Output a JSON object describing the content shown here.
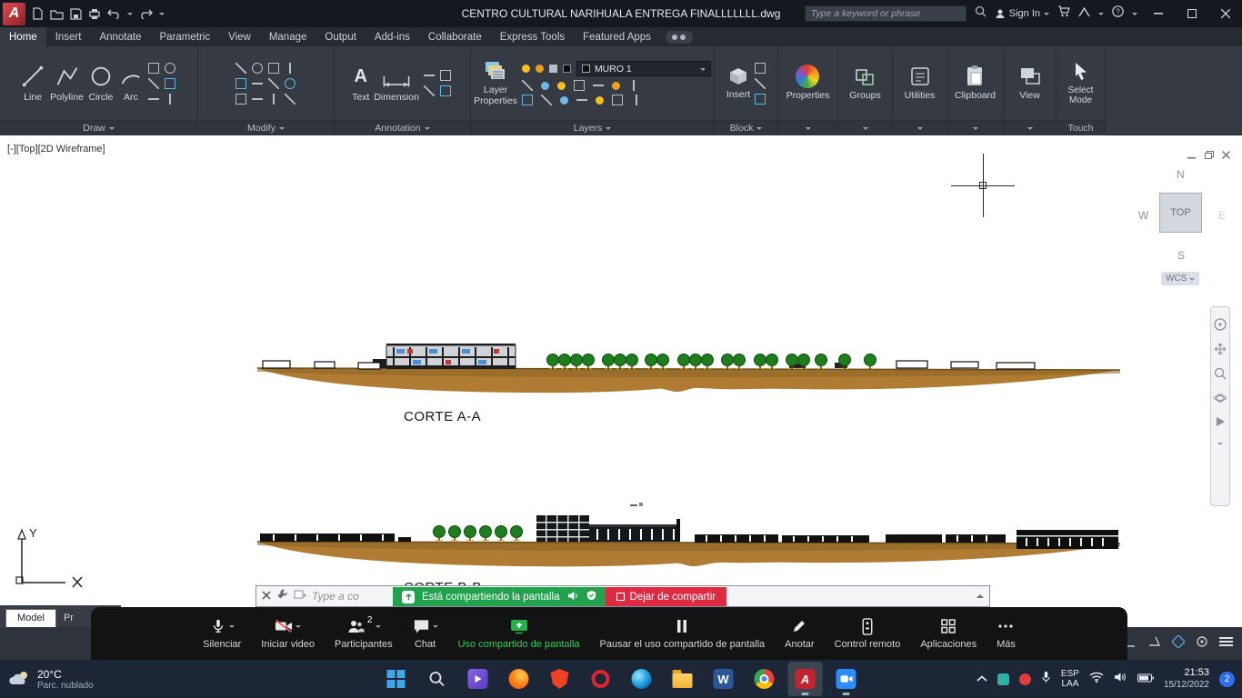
{
  "colors": {
    "terrain": "#b07c33",
    "terrain-stroke": "#6e4f1c",
    "tree": "#1e7e1e",
    "tree-stroke": "#0e4d0e",
    "share-green": "#23a24d",
    "stop-red": "#de2a43",
    "autocad-red": "#c2242f"
  },
  "logos": {
    "autocad_letter": "A",
    "word_letter": "W"
  },
  "titlebar": {
    "title": "CENTRO CULTURAL NARIHUALA ENTREGA FINALLLLLLL.dwg",
    "search_placeholder": "Type a keyword or phrase",
    "signin_label": "Sign In"
  },
  "ribbon": {
    "tabs": [
      "Home",
      "Insert",
      "Annotate",
      "Parametric",
      "View",
      "Manage",
      "Output",
      "Add-ins",
      "Collaborate",
      "Express Tools",
      "Featured Apps"
    ],
    "panels": {
      "draw": {
        "label": "Draw",
        "tools": [
          "Line",
          "Polyline",
          "Circle",
          "Arc"
        ]
      },
      "modify": {
        "label": "Modify"
      },
      "annotation": {
        "label": "Annotation",
        "tools": [
          "Text",
          "Dimension"
        ],
        "text_icon_letter": "A"
      },
      "layers": {
        "label": "Layers",
        "layer_properties": "Layer Properties",
        "current_layer": "MURO 1"
      },
      "block": {
        "label": "Block",
        "insert": "Insert"
      },
      "properties": {
        "label": "Properties"
      },
      "groups": {
        "label": "Groups"
      },
      "utilities": {
        "label": "Utilities"
      },
      "clipboard": {
        "label": "Clipboard"
      },
      "view": {
        "label": "View"
      },
      "select_mode": {
        "label": "Select Mode",
        "footer": "Touch"
      }
    }
  },
  "canvas": {
    "viewport_label": "[-][Top][2D Wireframe]",
    "viewcube": {
      "n": "N",
      "w": "W",
      "e": "E",
      "s": "S",
      "top": "TOP",
      "wcs": "WCS"
    },
    "sections": [
      {
        "label": "CORTE A-A"
      },
      {
        "label": "CORTE B-B"
      }
    ],
    "ucs_y_label": "Y"
  },
  "command_line": {
    "prompt_placeholder": "Type a co"
  },
  "share_banner": {
    "message": "Está compartiendo la pantalla",
    "stop_label": "Dejar de compartir"
  },
  "layout_tabs": {
    "model": "Model",
    "partial": "Pr"
  },
  "meeting_toolbar": {
    "items": [
      {
        "label": "Silenciar"
      },
      {
        "label": "Iniciar video"
      },
      {
        "label": "Participantes",
        "badge": "2"
      },
      {
        "label": "Chat"
      },
      {
        "label": "Uso compartido de pantalla"
      },
      {
        "label": "Pausar el uso compartido de pantalla"
      },
      {
        "label": "Anotar"
      },
      {
        "label": "Control remoto"
      },
      {
        "label": "Aplicaciones"
      },
      {
        "label": "Más"
      }
    ]
  },
  "taskbar": {
    "weather_temp": "20°C",
    "weather_desc": "Parc. nublado",
    "lang_top": "ESP",
    "lang_bottom": "LAA",
    "time": "21:53",
    "date": "15/12/2022",
    "notification_count": "2"
  }
}
